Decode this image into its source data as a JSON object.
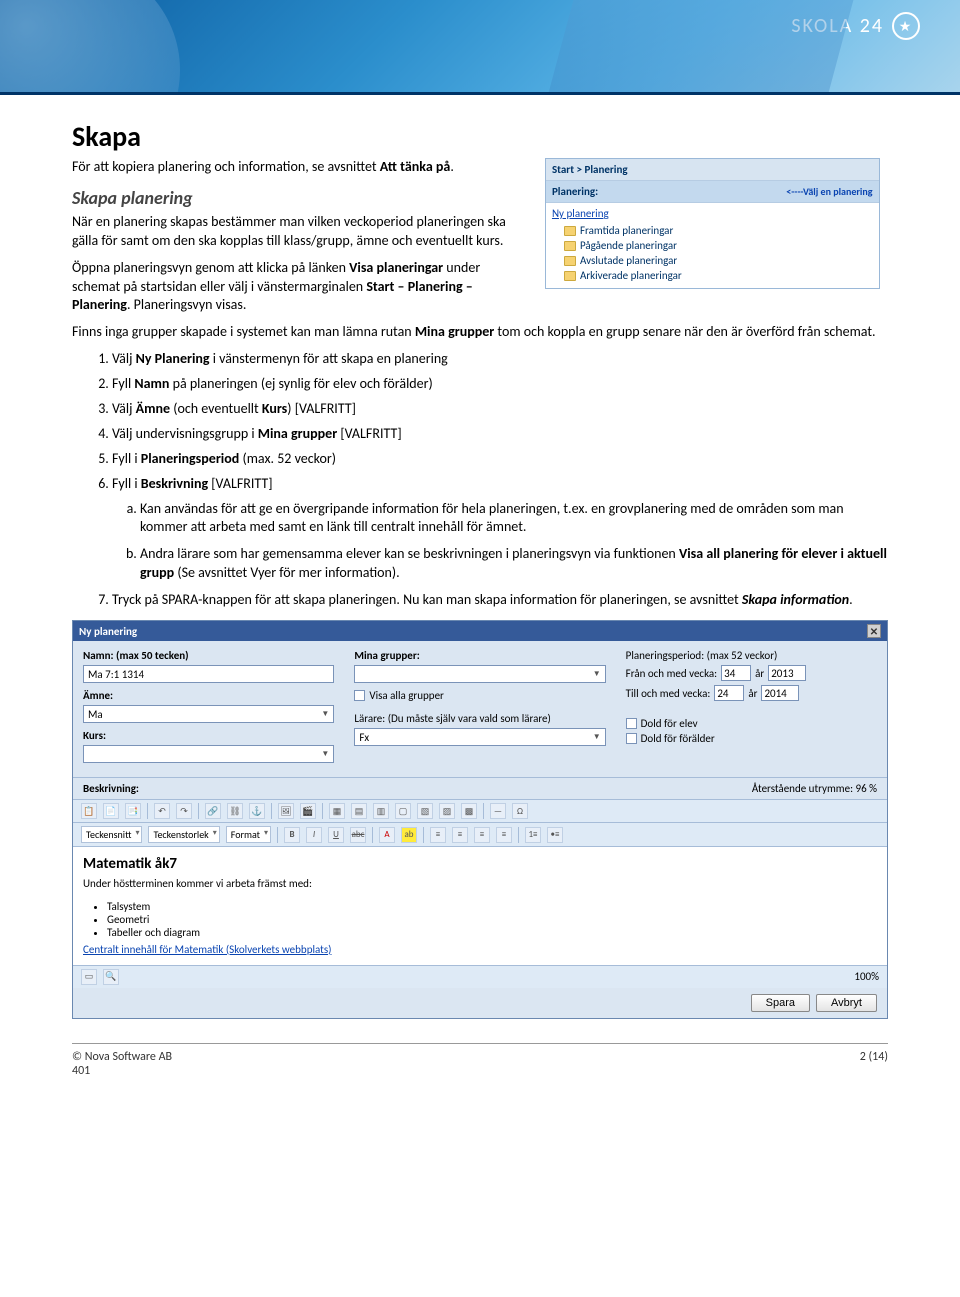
{
  "brand": {
    "name": "SKOLA 24"
  },
  "h1": "Skapa",
  "intro_p1_a": "För att kopiera planering och information, se avsnittet ",
  "intro_p1_b": "Att tänka på",
  "intro_p1_c": ".",
  "h2": "Skapa planering",
  "intro_p2": "När en planering skapas bestämmer man vilken veckoperiod planeringen ska gälla för samt om den ska kopplas till klass/grupp, ämne och eventuellt kurs.",
  "intro_p3_a": "Öppna planeringsvyn genom att klicka på länken ",
  "intro_p3_b": "Visa planeringar",
  "intro_p3_c": " under schemat på startsidan eller välj i vänstermarginalen ",
  "intro_p3_d": "Start – Planering – Planering",
  "intro_p3_e": ". Planeringsvyn visas.",
  "intro_p4_a": "Finns inga grupper skapade i systemet kan man lämna rutan ",
  "intro_p4_b": "Mina grupper",
  "intro_p4_c": " tom och koppla en grupp senare när den är överförd från schemat.",
  "list": {
    "i1_a": "Välj ",
    "i1_b": "Ny Planering",
    "i1_c": " i vänstermenyn för att skapa en planering",
    "i2_a": "Fyll ",
    "i2_b": "Namn",
    "i2_c": " på planeringen (ej synlig för elev och förälder)",
    "i3_a": "Välj ",
    "i3_b": "Ämne",
    "i3_c": " (och eventuellt ",
    "i3_d": "Kurs",
    "i3_e": ") [VALFRITT]",
    "i4_a": "Välj undervisningsgrupp i ",
    "i4_b": "Mina grupper",
    "i4_c": " [VALFRITT]",
    "i5_a": "Fyll i ",
    "i5_b": "Planeringsperiod",
    "i5_c": " (max. 52 veckor)",
    "i6_a": "Fyll i ",
    "i6_b": "Beskrivning",
    "i6_c": " [VALFRITT]",
    "i6a": "Kan användas för att ge en övergripande information för hela planeringen, t.ex. en grovplanering med de områden som man kommer att arbeta med samt en länk till centralt innehåll för ämnet.",
    "i6b_a": "Andra lärare som har gemensamma elever kan se beskrivningen i planeringsvyn via funktionen ",
    "i6b_b": "Visa all planering för elever i aktuell grupp",
    "i6b_c": " (Se avsnittet Vyer för mer information).",
    "i7_a": "Tryck på SPARA-knappen för att skapa planeringen. Nu kan man skapa information för planeringen, se avsnittet ",
    "i7_b": "Skapa information",
    "i7_c": "."
  },
  "sidepanel": {
    "crumb": "Start > Planering",
    "hint": "<----Välj en planering",
    "sec": "Planering:",
    "link": "Ny planering",
    "folders": [
      "Framtida planeringar",
      "Pågående planeringar",
      "Avslutade planeringar",
      "Arkiverade planeringar"
    ]
  },
  "editor": {
    "title": "Ny planering",
    "namn_lbl": "Namn: (max 50 tecken)",
    "namn_val": "Ma 7:1 1314",
    "amne_lbl": "Ämne:",
    "amne_val": "Ma",
    "kurs_lbl": "Kurs:",
    "mina_lbl": "Mina grupper:",
    "visa_alla": "Visa alla grupper",
    "larare_lbl": "Lärare: (Du måste själv vara vald som lärare)",
    "larare_val": "Fx",
    "period_lbl": "Planeringsperiod: (max 52 veckor)",
    "fran": "Från och med vecka:",
    "fran_v": "34",
    "fran_ar_lbl": "år",
    "fran_ar": "2013",
    "till": "Till och med vecka:",
    "till_v": "24",
    "till_ar_lbl": "år",
    "till_ar": "2014",
    "dold_elev": "Dold för elev",
    "dold_foralder": "Dold för förälder",
    "beskr_lbl": "Beskrivning:",
    "utrymme": "Återstående utrymme: 96 %",
    "tb": {
      "teckensnitt": "Teckensnitt",
      "storlek": "Teckenstorlek",
      "format": "Format"
    },
    "rte": {
      "h": "Matematik åk7",
      "p": "Under höstterminen kommer vi arbeta främst med:",
      "items": [
        "Talsystem",
        "Geometri",
        "Tabeller och diagram"
      ],
      "link": "Centralt innehåll för Matematik (Skolverkets webbplats)"
    },
    "hundra": "100%",
    "spara": "Spara",
    "avbryt": "Avbryt"
  },
  "footer": {
    "copyright": "© Nova Software AB",
    "code": "401",
    "page": "2 (14)"
  }
}
